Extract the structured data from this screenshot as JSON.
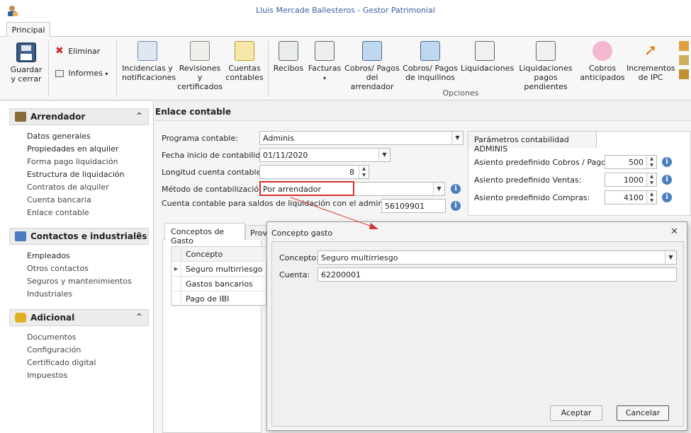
{
  "window": {
    "title": "Lluis Mercade Ballesteros - Gestor Patrimonial"
  },
  "ribbon": {
    "tab": "Principal",
    "group_label": "Opciones",
    "buttons": {
      "guardar": "Guardar\ny cerrar",
      "eliminar": "Eliminar",
      "informes": "Informes",
      "incidencias": "Incidencias y\nnotificaciones",
      "revisiones": "Revisiones y\ncertificados",
      "cuentas": "Cuentas\ncontables",
      "recibos": "Recibos",
      "facturas": "Facturas",
      "cobros_arr": "Cobros/ Pagos\ndel arrendador",
      "cobros_inq": "Cobros/ Pagos\nde inquilinos",
      "liquidaciones": "Liquidaciones",
      "liq_pend": "Liquidaciones\npagos pendientes",
      "cobros_ant": "Cobros\nanticipados",
      "ipc": "Incrementos\nde IPC"
    }
  },
  "sidebar": {
    "arrendador": {
      "title": "Arrendador",
      "items": [
        "Datos generales",
        "Propiedades en alquiler",
        "Forma pago liquidación",
        "Estructura de liquidación",
        "Contratos de alquiler",
        "Cuenta bancaria",
        "Enlace contable"
      ]
    },
    "contactos": {
      "title": "Contactos e industriales",
      "items": [
        "Empleados",
        "Otros contactos",
        "Seguros y mantenimientos",
        "Industriales"
      ]
    },
    "adicional": {
      "title": "Adicional",
      "items": [
        "Documentos",
        "Configuración",
        "Certificado digital",
        "Impuestos"
      ]
    }
  },
  "main": {
    "header": "Enlace contable",
    "programa_label": "Programa contable:",
    "programa_value": "Adminis",
    "fecha_label": "Fecha inicio de contabilidad:",
    "fecha_value": "01/11/2020",
    "longitud_label": "Longitud cuenta contable:",
    "longitud_value": "8",
    "metodo_label": "Método de contabilización:",
    "metodo_value": "Por arrendador",
    "cuenta_saldos_label": "Cuenta contable para saldos de liquidación con el administrador",
    "cuenta_saldos_value": "56109901",
    "params": {
      "tab": "Parámetros contabilidad ADMINIS",
      "cobros_label": "Asiento  predefinido Cobros / Pagos:",
      "cobros_value": "500",
      "ventas_label": "Asiento  predefinido Ventas:",
      "ventas_value": "1000",
      "compras_label": "Asiento predefinido Compras:",
      "compras_value": "4100"
    },
    "tabs": [
      "Conceptos de Gasto",
      "Prov"
    ],
    "grid": {
      "header": "Concepto",
      "rows": [
        "Seguro multirriesgo",
        "Gastos bancarios",
        "Pago de IBI"
      ]
    }
  },
  "dialog": {
    "title": "Concepto gasto",
    "concepto_label": "Concepto:",
    "concepto_value": "Seguro multirriesgo",
    "cuenta_label": "Cuenta:",
    "cuenta_value": "62200001",
    "accept": "Aceptar",
    "cancel": "Cancelar"
  }
}
